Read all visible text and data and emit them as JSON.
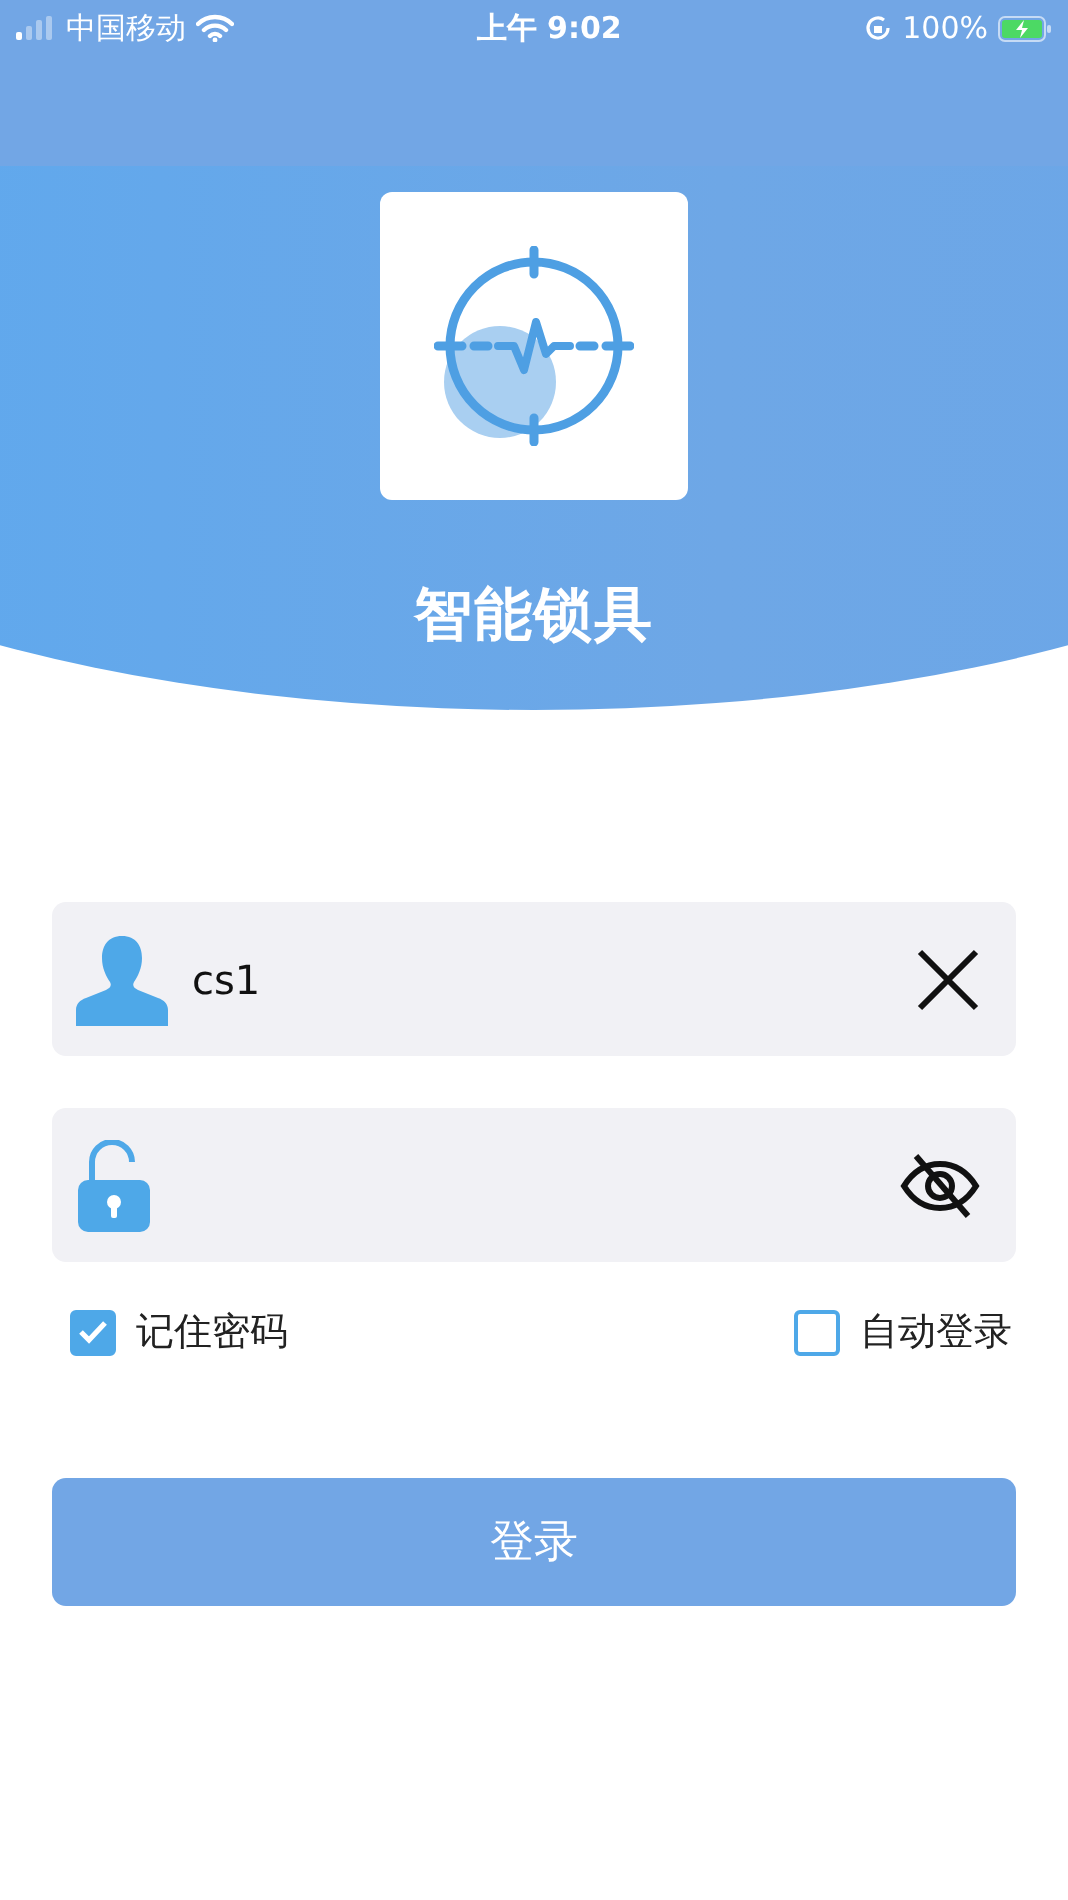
{
  "status_bar": {
    "carrier": "中国移动",
    "time": "上午 9:02",
    "battery": "100%"
  },
  "app": {
    "title": "智能锁具"
  },
  "username": {
    "value": "cs1"
  },
  "password": {
    "visible": false
  },
  "options": [
    {
      "label": "记住密码",
      "checked": true
    },
    {
      "label": "自动登录",
      "checked": false
    }
  ],
  "login_button": {
    "label": "登录"
  }
}
